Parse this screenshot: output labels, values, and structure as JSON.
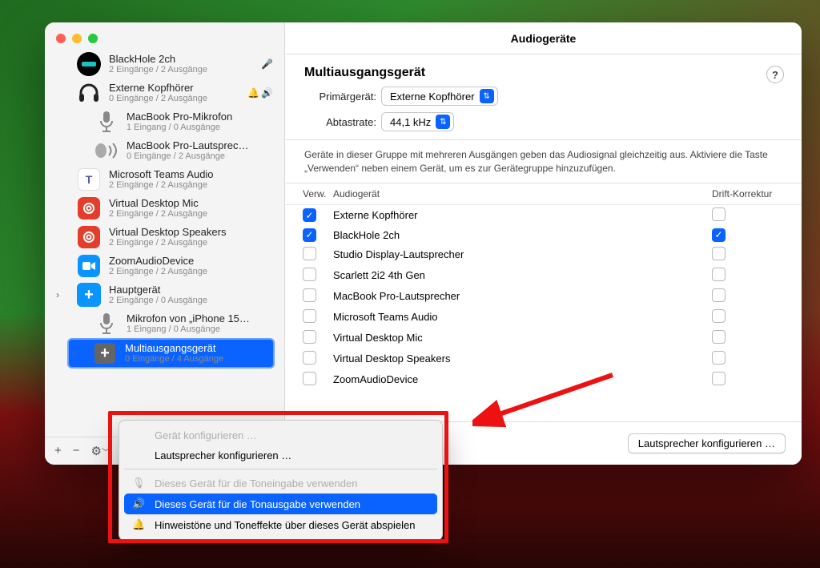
{
  "window": {
    "title": "Audiogeräte"
  },
  "sidebar": {
    "items": [
      {
        "name": "BlackHole 2ch",
        "sub": "2 Eingänge / 2 Ausgänge",
        "kind": "blackhole",
        "mic_badge": true
      },
      {
        "name": "Externe Kopfhörer",
        "sub": "0 Eingänge / 2 Ausgänge",
        "kind": "headphones",
        "alert_badge": true,
        "speaker_badge": true
      },
      {
        "name": "MacBook Pro-Mikrofon",
        "sub": "1 Eingang / 0 Ausgänge",
        "kind": "mic",
        "indent": true
      },
      {
        "name": "MacBook Pro-Lautsprec…",
        "sub": "0 Eingänge / 2 Ausgänge",
        "kind": "speaker",
        "indent": true
      },
      {
        "name": "Microsoft Teams Audio",
        "sub": "2 Eingänge / 2 Ausgänge",
        "kind": "teams"
      },
      {
        "name": "Virtual Desktop Mic",
        "sub": "2 Eingänge / 2 Ausgänge",
        "kind": "vd"
      },
      {
        "name": "Virtual Desktop Speakers",
        "sub": "2 Eingänge / 2 Ausgänge",
        "kind": "vd"
      },
      {
        "name": "ZoomAudioDevice",
        "sub": "2 Eingänge / 2 Ausgänge",
        "kind": "zoom"
      },
      {
        "name": "Hauptgerät",
        "sub": "2 Eingänge / 0 Ausgänge",
        "kind": "agg",
        "expand": true
      },
      {
        "name": "Mikrofon von „iPhone 15…",
        "sub": "1 Eingang / 0 Ausgänge",
        "kind": "iphone-mic",
        "indent": true
      },
      {
        "name": "Multiausgangsgerät",
        "sub": "0 Eingänge / 4 Ausgänge",
        "kind": "multiOut",
        "expand": true,
        "selected": true
      }
    ],
    "footer": {
      "plus": "+",
      "minus": "−",
      "gear": "⚙︎"
    }
  },
  "config": {
    "heading": "Multiausgangsgerät",
    "primary_label": "Primärgerät:",
    "primary_value": "Externe Kopfhörer",
    "rate_label": "Abtastrate:",
    "rate_value": "44,1 kHz",
    "desc": "Geräte in dieser Gruppe mit mehreren Ausgängen geben das Audiosignal gleichzeitig aus. Aktiviere die Taste „Verwenden“ neben einem Gerät, um es zur Gerätegruppe hinzuzufügen.",
    "colVerw": "Verw.",
    "colDev": "Audiogerät",
    "colDrift": "Drift-Korrektur",
    "rows": [
      {
        "name": "Externe Kopfhörer",
        "use": true,
        "drift": false
      },
      {
        "name": "BlackHole 2ch",
        "use": true,
        "drift": true
      },
      {
        "name": "Studio Display-Lautsprecher",
        "use": false,
        "drift": false
      },
      {
        "name": "Scarlett 2i2 4th Gen",
        "use": false,
        "drift": false
      },
      {
        "name": "MacBook Pro-Lautsprecher",
        "use": false,
        "drift": false
      },
      {
        "name": "Microsoft Teams Audio",
        "use": false,
        "drift": false
      },
      {
        "name": "Virtual Desktop Mic",
        "use": false,
        "drift": false
      },
      {
        "name": "Virtual Desktop Speakers",
        "use": false,
        "drift": false
      },
      {
        "name": "ZoomAudioDevice",
        "use": false,
        "drift": false
      }
    ],
    "footer_btn": "Lautsprecher konfigurieren …"
  },
  "menu": {
    "items": [
      {
        "label": "Gerät konfigurieren …",
        "disabled": true
      },
      {
        "label": "Lautsprecher konfigurieren …"
      },
      {
        "sep": true
      },
      {
        "label": "Dieses Gerät für die Toneingabe verwenden",
        "disabled": true,
        "icon": "mic"
      },
      {
        "label": "Dieses Gerät für die Tonausgabe verwenden",
        "highlight": true,
        "icon": "speaker"
      },
      {
        "label": "Hinweistöne und Toneffekte über dieses Gerät abspielen",
        "icon": "alert"
      }
    ]
  }
}
